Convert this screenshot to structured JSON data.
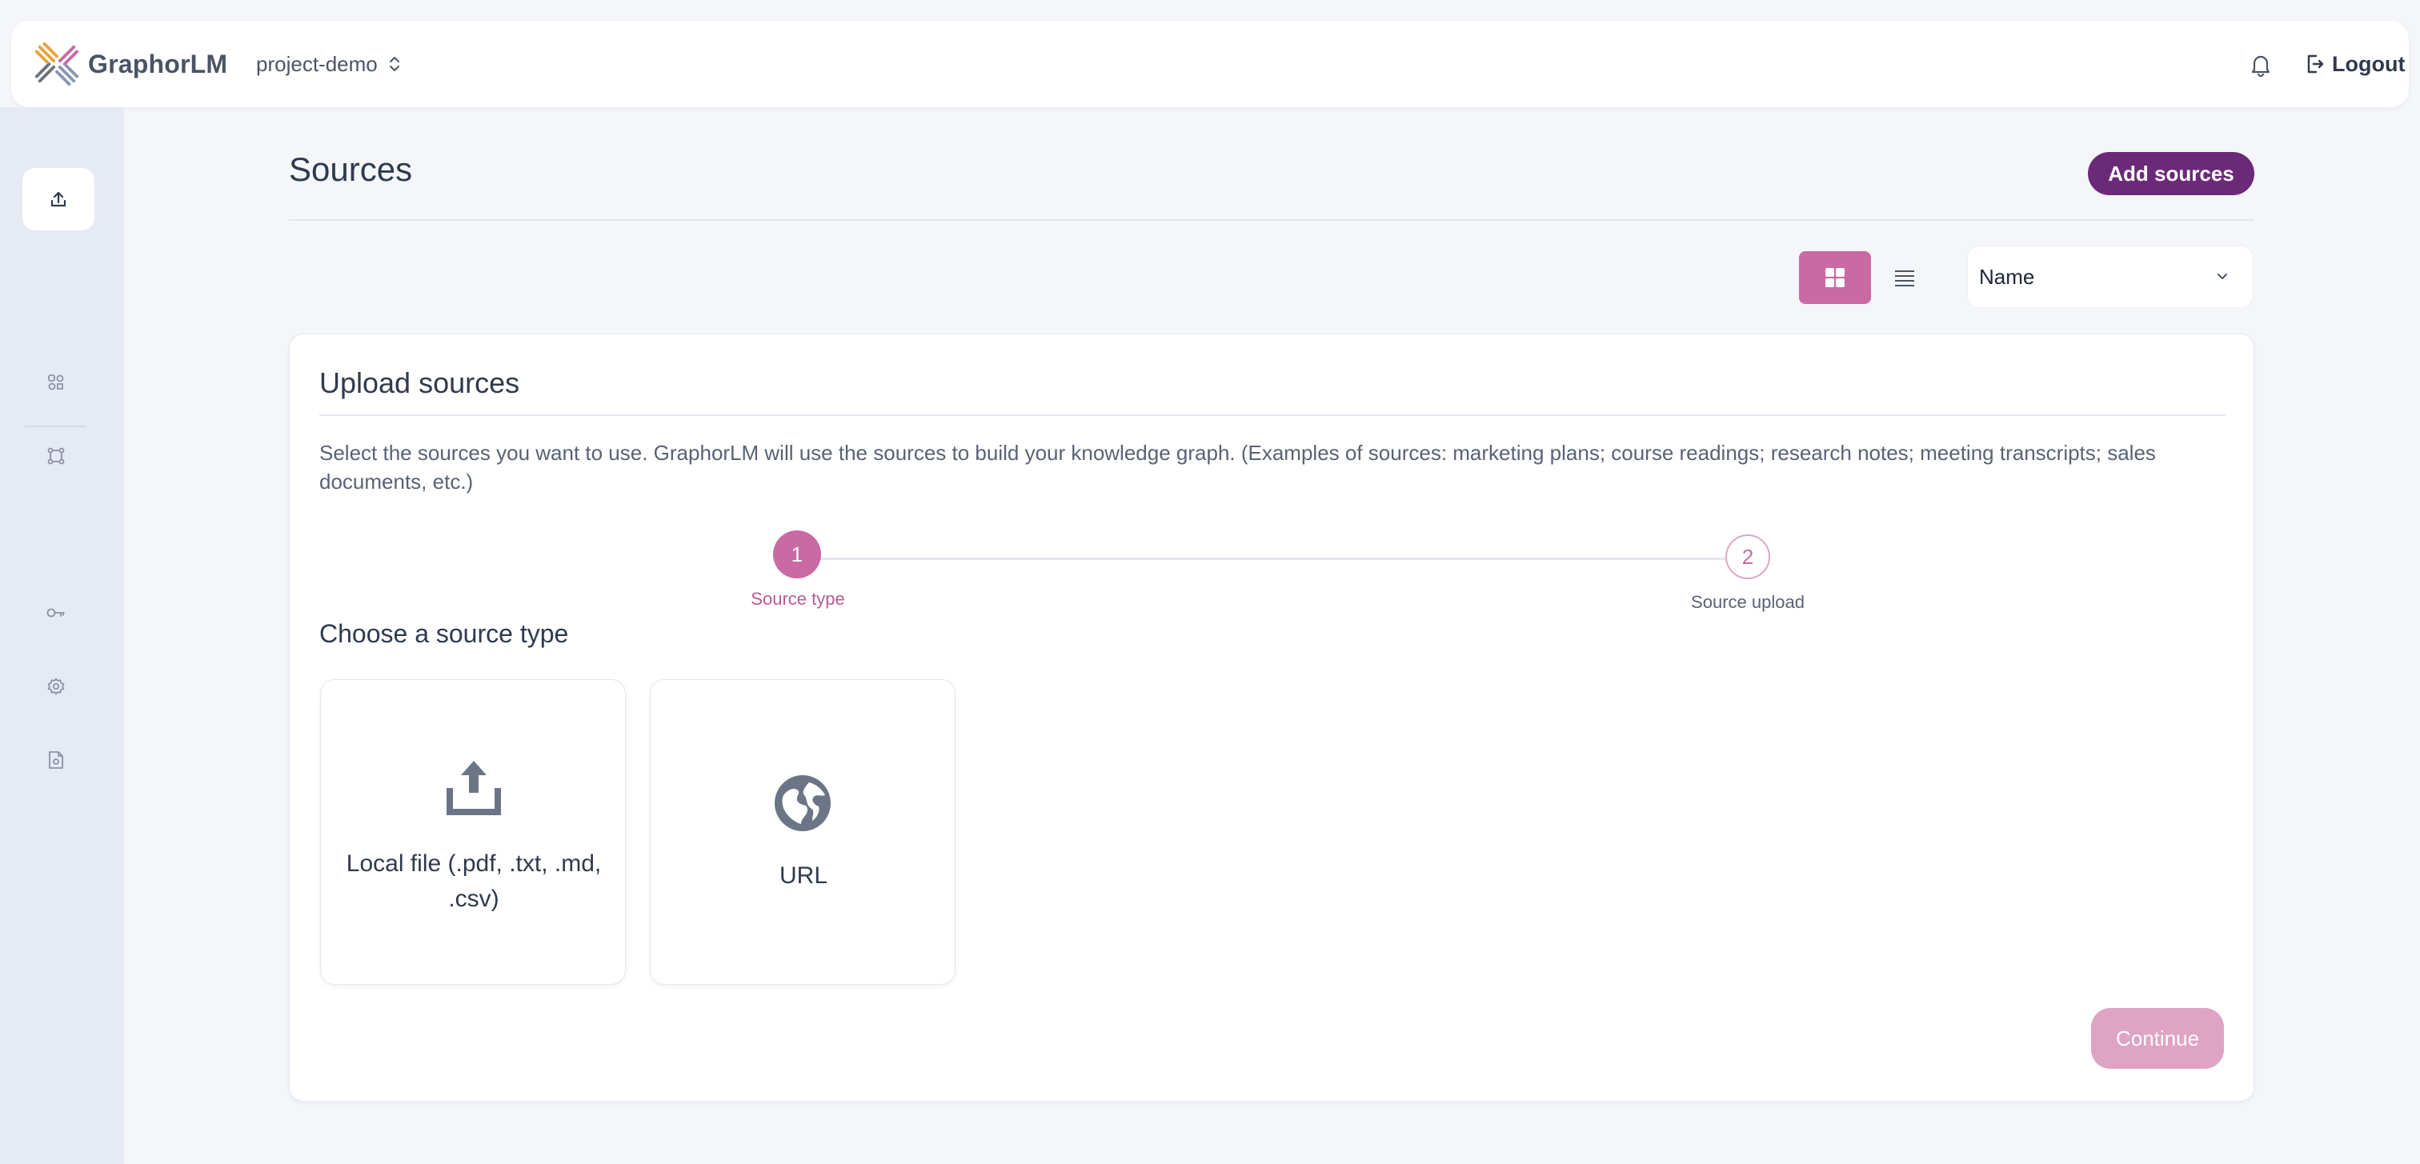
{
  "header": {
    "brand": "GraphorLM",
    "project": "project-demo",
    "logout_label": "Logout"
  },
  "sidebar": {
    "items": [
      {
        "icon": "upload-icon",
        "active": true
      },
      {
        "icon": "nodes-icon",
        "active": false
      },
      {
        "icon": "flow-icon",
        "active": false
      },
      {
        "icon": "key-icon",
        "active": false
      },
      {
        "icon": "gear-icon",
        "active": false
      },
      {
        "icon": "document-icon",
        "active": false
      }
    ]
  },
  "page": {
    "title": "Sources",
    "add_button": "Add sources",
    "sort_value": "Name"
  },
  "upload": {
    "title": "Upload sources",
    "description": "Select the sources you want to use. GraphorLM will use the sources to build your knowledge graph. (Examples of sources: marketing plans; course readings; research notes; meeting transcripts; sales documents, etc.)",
    "steps": [
      {
        "number": "1",
        "label": "Source type",
        "active": true
      },
      {
        "number": "2",
        "label": "Source upload",
        "active": false
      }
    ],
    "choose_title": "Choose a source type",
    "options": [
      {
        "label": "Local file (.pdf, .txt, .md, .csv)",
        "icon": "upload-tray-icon"
      },
      {
        "label": "URL",
        "icon": "globe-icon"
      }
    ],
    "continue_label": "Continue"
  },
  "colors": {
    "accent": "#c96aa5",
    "primary_button": "#6b2a78",
    "continue_disabled": "#dfa3c4",
    "sidebar_bg": "#e6eaf2",
    "page_bg": "#f4f6fa"
  }
}
